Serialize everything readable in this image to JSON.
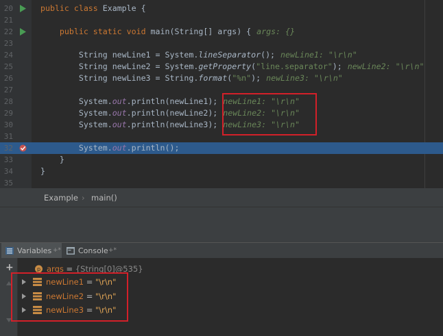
{
  "editor": {
    "lines": [
      {
        "num": "20",
        "icon": "run",
        "code": [
          {
            "t": "public class ",
            "c": "kw"
          },
          {
            "t": "Example {",
            "c": ""
          }
        ]
      },
      {
        "num": "21",
        "code": []
      },
      {
        "num": "22",
        "icon": "run",
        "code": [
          {
            "t": "    ",
            "c": ""
          },
          {
            "t": "public static void ",
            "c": "kw"
          },
          {
            "t": "main",
            "c": "fn"
          },
          {
            "t": "(String[] args) {",
            "c": ""
          }
        ],
        "hint": "args: {}"
      },
      {
        "num": "23",
        "code": []
      },
      {
        "num": "24",
        "code": [
          {
            "t": "        String newLine1 = System.",
            "c": ""
          },
          {
            "t": "lineSeparator",
            "c": "sm"
          },
          {
            "t": "();",
            "c": ""
          }
        ],
        "hint": "newLine1: \"\\r\\n\""
      },
      {
        "num": "25",
        "code": [
          {
            "t": "        String newLine2 = System.",
            "c": ""
          },
          {
            "t": "getProperty",
            "c": "sm"
          },
          {
            "t": "(",
            "c": ""
          },
          {
            "t": "\"line.separator\"",
            "c": "str"
          },
          {
            "t": ");",
            "c": ""
          }
        ],
        "hint": "newLine2: \"\\r\\n\""
      },
      {
        "num": "26",
        "code": [
          {
            "t": "        String newLine3 = String.",
            "c": ""
          },
          {
            "t": "format",
            "c": "sm"
          },
          {
            "t": "(",
            "c": ""
          },
          {
            "t": "\"%n\"",
            "c": "str"
          },
          {
            "t": ");",
            "c": ""
          }
        ],
        "hint": "newLine3: \"\\r\\n\""
      },
      {
        "num": "27",
        "code": []
      },
      {
        "num": "28",
        "code": [
          {
            "t": "        System.",
            "c": ""
          },
          {
            "t": "out",
            "c": "fld"
          },
          {
            "t": ".println(newLine1);",
            "c": ""
          }
        ],
        "hint": "newLine1: \"\\r\\n\""
      },
      {
        "num": "29",
        "code": [
          {
            "t": "        System.",
            "c": ""
          },
          {
            "t": "out",
            "c": "fld"
          },
          {
            "t": ".println(newLine2);",
            "c": ""
          }
        ],
        "hint": "newLine2: \"\\r\\n\""
      },
      {
        "num": "30",
        "code": [
          {
            "t": "        System.",
            "c": ""
          },
          {
            "t": "out",
            "c": "fld"
          },
          {
            "t": ".println(newLine3);",
            "c": ""
          }
        ],
        "hint": "newLine3: \"\\r\\n\""
      },
      {
        "num": "31",
        "code": []
      },
      {
        "num": "32",
        "icon": "breakpoint",
        "current": true,
        "code": [
          {
            "t": "        System.",
            "c": ""
          },
          {
            "t": "out",
            "c": "fld"
          },
          {
            "t": ".println();",
            "c": ""
          }
        ]
      },
      {
        "num": "33",
        "code": [
          {
            "t": "    }",
            "c": ""
          }
        ]
      },
      {
        "num": "34",
        "code": [
          {
            "t": "}",
            "c": ""
          }
        ]
      },
      {
        "num": "35",
        "code": []
      }
    ]
  },
  "breadcrumb": {
    "class_name": "Example",
    "separator": "›",
    "method_name": "main()"
  },
  "tabs": [
    {
      "label": "Variables",
      "pin": "+*",
      "active": true,
      "icon": "variables-icon"
    },
    {
      "label": "Console",
      "pin": "+*",
      "active": false,
      "icon": "console-icon"
    }
  ],
  "variables": [
    {
      "name": "args",
      "eq": " = ",
      "value": "{String[0]@535}",
      "expandable": false,
      "icon": "parameter-icon"
    },
    {
      "name": "newLine1",
      "eq": " = ",
      "value": "\"\\r\\n\"",
      "expandable": true,
      "icon": "field-icon"
    },
    {
      "name": "newLine2",
      "eq": " = ",
      "value": "\"\\r\\n\"",
      "expandable": true,
      "icon": "field-icon"
    },
    {
      "name": "newLine3",
      "eq": " = ",
      "value": "\"\\r\\n\"",
      "expandable": true,
      "icon": "field-icon"
    }
  ],
  "toolbar": {
    "add_label": "+"
  },
  "colors": {
    "highlight_box": "#d42029",
    "current_line": "#2d5a8c",
    "run_icon": "#499c54"
  }
}
